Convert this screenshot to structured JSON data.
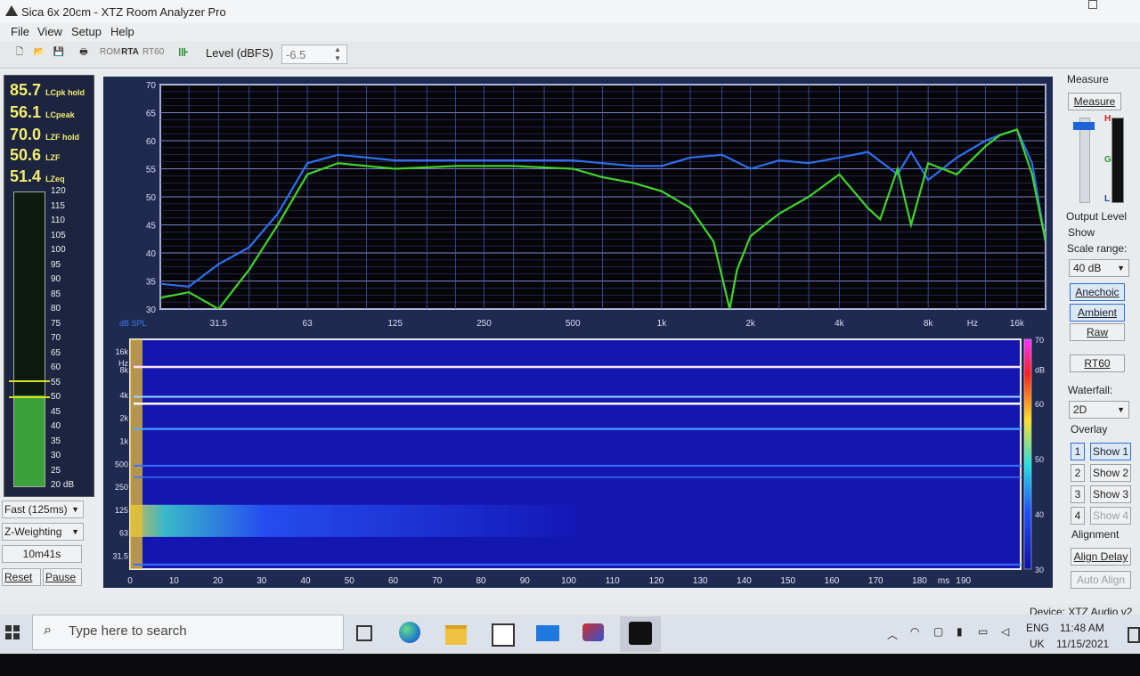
{
  "window": {
    "title": "Sica 6x 20cm - XTZ Room Analyzer Pro"
  },
  "menu": [
    "File",
    "View",
    "Setup",
    "Help"
  ],
  "toolbar": {
    "level_label": "Level (dBFS)",
    "level_value": "-6.5",
    "btn_rom": "ROM",
    "btn_rta": "RTA",
    "btn_rt60": "RT60"
  },
  "meter": {
    "readings": [
      {
        "value": "85.7",
        "label": "LCpk hold"
      },
      {
        "value": "56.1",
        "label": "LCpeak"
      },
      {
        "value": "70.0",
        "label": "LZF hold"
      },
      {
        "value": "50.6",
        "label": "LZF"
      },
      {
        "value": "51.4",
        "label": "LZeq"
      }
    ],
    "scale": [
      "120",
      "115",
      "110",
      "105",
      "100",
      "95",
      "90",
      "85",
      "80",
      "75",
      "70",
      "65",
      "60",
      "55",
      "50",
      "45",
      "40",
      "35",
      "30",
      "25",
      "20 dB"
    ],
    "level_db": 51,
    "time_weighting": "Fast (125ms)",
    "freq_weighting": "Z-Weighting",
    "elapsed": "10m41s",
    "reset": "Reset",
    "pause": "Pause"
  },
  "freq_plot": {
    "y_ticks": [
      "70",
      "65",
      "60",
      "55",
      "50",
      "45",
      "40",
      "35",
      "30"
    ],
    "x_ticks": [
      "31.5",
      "63",
      "125",
      "250",
      "500",
      "1k",
      "2k",
      "4k",
      "8k",
      "Hz",
      "16k"
    ],
    "unit_label": "dB SPL"
  },
  "spectrogram": {
    "y_ticks": [
      "16k",
      "Hz",
      "8k",
      "4k",
      "2k",
      "1k",
      "500",
      "250",
      "125",
      "63",
      "31.5"
    ],
    "x_ticks": [
      "0",
      "10",
      "20",
      "30",
      "40",
      "50",
      "60",
      "70",
      "80",
      "90",
      "100",
      "110",
      "120",
      "130",
      "140",
      "150",
      "160",
      "170",
      "180",
      "ms",
      "190"
    ],
    "scale_ticks": [
      "70",
      "dB",
      "60",
      "50",
      "40",
      "30"
    ]
  },
  "right": {
    "measure_header": "Measure",
    "measure_btn": "Measure",
    "output_level": "Output Level",
    "show": "Show",
    "scale_range": "Scale range:",
    "scale_value": "40 dB",
    "anechoic": "Anechoic",
    "ambient": "Ambient",
    "raw": "Raw",
    "rt60": "RT60",
    "waterfall": "Waterfall:",
    "waterfall_value": "2D",
    "overlay": "Overlay",
    "overlay_nums": [
      "1",
      "2",
      "3",
      "4"
    ],
    "overlay_show": [
      "Show 1",
      "Show 2",
      "Show 3",
      "Show 4"
    ],
    "alignment": "Alignment",
    "align_delay": "Align Delay",
    "auto_align": "Auto Align",
    "vu_h": "H",
    "vu_g": "G",
    "vu_l": "L"
  },
  "status": {
    "device": "Device: XTZ Audio v2"
  },
  "taskbar": {
    "search_placeholder": "Type here to search",
    "lang1": "ENG",
    "lang2": "UK",
    "time": "11:48 AM",
    "date": "11/15/2021"
  },
  "chart_data": {
    "type": "line",
    "x_scale": "log",
    "xlim": [
      20,
      20000
    ],
    "ylim": [
      30,
      70
    ],
    "series": [
      {
        "color": "#2f6ff0",
        "x": [
          20,
          25,
          31.5,
          40,
          50,
          63,
          80,
          100,
          125,
          200,
          315,
          500,
          630,
          800,
          1000,
          1250,
          1600,
          2000,
          2500,
          3150,
          4000,
          5000,
          6300,
          7000,
          8000,
          10000,
          12500,
          14000,
          16000,
          18000,
          20000
        ],
        "y": [
          34.5,
          34,
          38,
          41,
          47,
          56,
          57.5,
          57,
          56.5,
          56.5,
          56.5,
          56.5,
          56,
          55.5,
          55.5,
          57,
          57.5,
          55,
          56.5,
          56,
          57,
          58,
          54,
          58,
          53,
          57,
          60,
          61,
          62,
          56,
          42
        ]
      },
      {
        "color": "#42d42a",
        "x": [
          20,
          25,
          31.5,
          40,
          50,
          63,
          80,
          100,
          125,
          200,
          315,
          500,
          630,
          800,
          1000,
          1250,
          1500,
          1700,
          1800,
          2000,
          2500,
          3150,
          4000,
          5000,
          5500,
          6300,
          7000,
          8000,
          10000,
          12500,
          14000,
          16000,
          18000,
          20000
        ],
        "y": [
          32,
          33,
          30,
          37,
          45,
          54,
          56,
          55.5,
          55,
          55.5,
          55.5,
          55,
          53.5,
          52.5,
          51,
          48,
          42,
          30,
          37,
          43,
          47,
          50,
          54,
          48,
          46,
          55,
          45,
          56,
          54,
          59,
          61,
          62,
          54,
          42
        ]
      }
    ]
  }
}
